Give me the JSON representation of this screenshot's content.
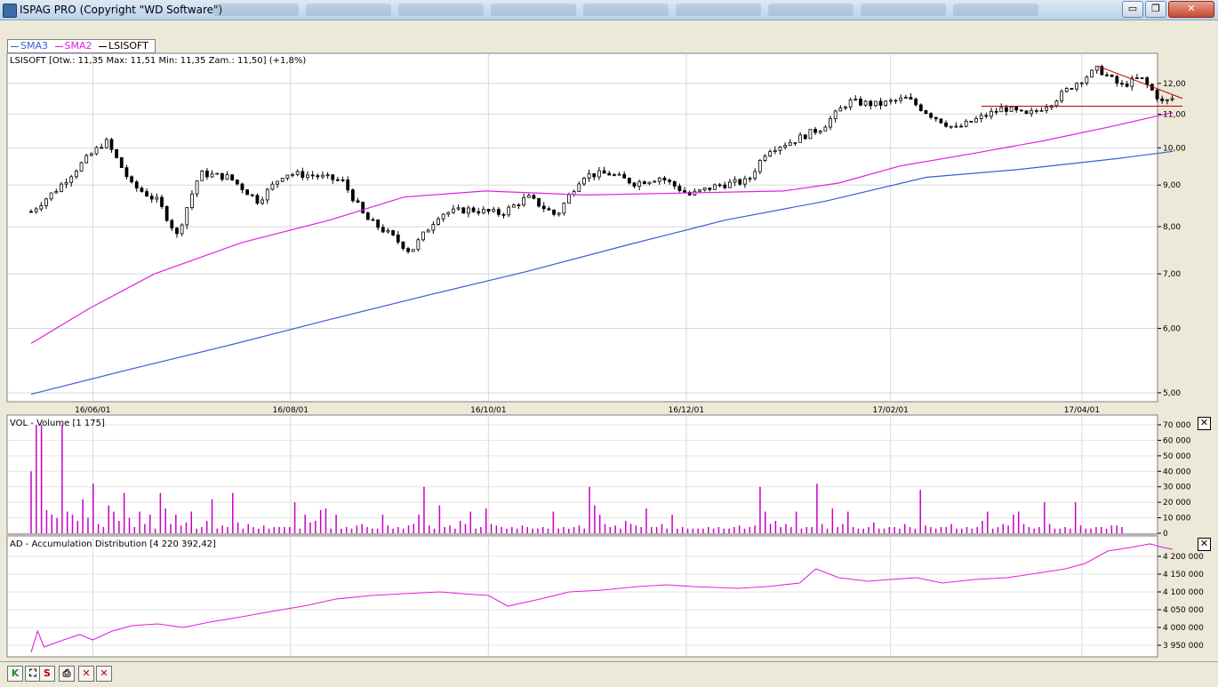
{
  "window": {
    "title": "ISPAG PRO (Copyright \"WD Software\")",
    "minimize_glyph": "▭",
    "restore_glyph": "❐",
    "close_glyph": "✕"
  },
  "legend": {
    "items": [
      {
        "label": "SMA3",
        "color": "#3a5fcd"
      },
      {
        "label": "SMA2",
        "color": "#e020e0"
      },
      {
        "label": "LSISOFT",
        "color": "#000000"
      }
    ]
  },
  "price_panel": {
    "info": "LSISOFT [Otw.: 11,35  Max: 11,51  Min: 11,35  Zam.: 11,50] (+1,8%)",
    "y_ticks": [
      "12,00",
      "11,00",
      "10,00",
      "9,00",
      "8,00",
      "7,00",
      "6,00",
      "5,00"
    ],
    "x_ticks": [
      "16/06/01",
      "16/08/01",
      "16/10/01",
      "16/12/01",
      "17/02/01",
      "17/04/01"
    ]
  },
  "volume_panel": {
    "info": "VOL - Volume [1 175]",
    "y_ticks": [
      "70 000",
      "60 000",
      "50 000",
      "40 000",
      "30 000",
      "20 000",
      "10 000",
      "0"
    ],
    "close_glyph": "✕"
  },
  "ad_panel": {
    "info": "AD - Accumulation Distribution [4 220 392,42]",
    "y_ticks": [
      "4 200 000",
      "4 150 000",
      "4 100 000",
      "4 050 000",
      "4 000 000",
      "3 950 000"
    ],
    "close_glyph": "✕"
  },
  "toolbar": {
    "buttons": [
      {
        "label": "K",
        "icon": "k-icon"
      },
      {
        "label": "⛶",
        "icon": "fit-icon"
      },
      {
        "label": "S",
        "icon": "s-icon"
      },
      {
        "label": "⎙",
        "icon": "print-icon"
      },
      {
        "label": "✕",
        "icon": "delete-icon"
      },
      {
        "label": "✕",
        "icon": "delete-all-icon"
      }
    ]
  },
  "chart_data": [
    {
      "type": "candlestick",
      "scale": "log",
      "title": "LSISOFT",
      "ylim": [
        4.9,
        13.0
      ],
      "x_range": [
        "2001-05-28",
        "2002-05-18"
      ],
      "x_tick_dates": [
        "2001-06-16",
        "2001-08-16",
        "2001-10-16",
        "2001-12-16",
        "2002-02-17",
        "2002-04-17"
      ],
      "grid": true,
      "legend_position": "top-left",
      "series_colors": {
        "SMA3": "#3a5fcd",
        "SMA2": "#e020e0",
        "LSISOFT": "#000000"
      },
      "close": [
        [
          [
            "2001-05-28",
            8.35
          ]
        ],
        [
          [
            "2001-06-05",
            8.9
          ]
        ],
        [
          [
            "2001-06-13",
            9.6
          ]
        ],
        [
          [
            "2001-06-20",
            10.2
          ]
        ],
        [
          [
            "2001-06-28",
            9.0
          ]
        ],
        [
          [
            "2001-07-06",
            8.6
          ]
        ],
        [
          [
            "2001-07-12",
            7.8
          ]
        ],
        [
          [
            "2001-07-19",
            9.3
          ]
        ],
        [
          [
            "2001-07-28",
            9.2
          ]
        ],
        [
          [
            "2001-08-06",
            8.6
          ]
        ],
        [
          [
            "2001-08-14",
            9.3
          ]
        ],
        [
          [
            "2001-08-23",
            9.25
          ]
        ],
        [
          [
            "2001-09-01",
            9.1
          ]
        ],
        [
          [
            "2001-09-08",
            8.2
          ]
        ],
        [
          [
            "2001-09-16",
            7.8
          ]
        ],
        [
          [
            "2001-09-22",
            7.45
          ]
        ],
        [
          [
            "2001-10-01",
            8.3
          ]
        ],
        [
          [
            "2001-10-10",
            8.4
          ]
        ],
        [
          [
            "2001-10-20",
            8.3
          ]
        ],
        [
          [
            "2001-10-28",
            8.7
          ]
        ],
        [
          [
            "2001-11-06",
            8.25
          ]
        ],
        [
          [
            "2001-11-14",
            9.25
          ]
        ],
        [
          [
            "2001-11-22",
            9.3
          ]
        ],
        [
          [
            "2001-11-30",
            9.05
          ]
        ],
        [
          [
            "2001-12-08",
            9.2
          ]
        ],
        [
          [
            "2001-12-17",
            8.75
          ]
        ],
        [
          [
            "2001-12-26",
            9.0
          ]
        ],
        [
          [
            "2002-01-04",
            9.1
          ]
        ],
        [
          [
            "2002-01-10",
            9.95
          ]
        ],
        [
          [
            "2002-01-18",
            10.2
          ]
        ],
        [
          [
            "2002-01-27",
            10.6
          ]
        ],
        [
          [
            "2002-02-04",
            11.4
          ]
        ],
        [
          [
            "2002-02-13",
            11.3
          ]
        ],
        [
          [
            "2002-02-22",
            11.5
          ]
        ],
        [
          [
            "2002-03-01",
            11.0
          ]
        ],
        [
          [
            "2002-03-09",
            10.55
          ]
        ],
        [
          [
            "2002-03-17",
            10.9
          ]
        ],
        [
          [
            "2002-03-24",
            11.2
          ]
        ],
        [
          [
            "2002-03-31",
            10.95
          ]
        ],
        [
          [
            "2002-04-08",
            11.4
          ]
        ],
        [
          [
            "2002-04-15",
            12.0
          ]
        ],
        [
          [
            "2002-04-22",
            12.5
          ]
        ],
        [
          [
            "2002-04-29",
            11.9
          ]
        ],
        [
          [
            "2002-05-05",
            12.2
          ]
        ],
        [
          [
            "2002-05-12",
            11.35
          ]
        ],
        [
          [
            "2002-05-15",
            11.5
          ]
        ]
      ],
      "series": [
        {
          "name": "SMA3",
          "values": [
            [
              "2001-05-28",
              4.98
            ],
            [
              "2001-06-28",
              5.35
            ],
            [
              "2001-07-28",
              5.72
            ],
            [
              "2001-08-28",
              6.15
            ],
            [
              "2001-09-28",
              6.6
            ],
            [
              "2001-10-28",
              7.05
            ],
            [
              "2001-11-28",
              7.6
            ],
            [
              "2001-12-28",
              8.15
            ],
            [
              "2002-01-28",
              8.6
            ],
            [
              "2002-02-28",
              9.2
            ],
            [
              "2002-03-28",
              9.4
            ],
            [
              "2002-04-28",
              9.7
            ],
            [
              "2002-05-15",
              9.9
            ]
          ]
        },
        {
          "name": "SMA2",
          "values": [
            [
              "2001-05-28",
              5.75
            ],
            [
              "2001-06-15",
              6.35
            ],
            [
              "2001-07-05",
              7.0
            ],
            [
              "2001-08-01",
              7.65
            ],
            [
              "2001-08-28",
              8.15
            ],
            [
              "2001-09-20",
              8.7
            ],
            [
              "2001-10-15",
              8.85
            ],
            [
              "2001-11-15",
              8.75
            ],
            [
              "2001-12-15",
              8.8
            ],
            [
              "2002-01-15",
              8.85
            ],
            [
              "2002-02-01",
              9.05
            ],
            [
              "2002-02-20",
              9.5
            ],
            [
              "2002-03-15",
              9.85
            ],
            [
              "2002-04-05",
              10.2
            ],
            [
              "2002-04-25",
              10.6
            ],
            [
              "2002-05-15",
              11.05
            ]
          ]
        }
      ],
      "annotations": [
        {
          "type": "resistance_trendline",
          "from": [
            "2002-04-22",
            12.6
          ],
          "to": [
            "2002-05-18",
            11.5
          ],
          "color": "#c00000"
        },
        {
          "type": "support_line",
          "from": [
            "2002-03-17",
            11.25
          ],
          "to": [
            "2002-05-18",
            11.25
          ],
          "color": "#c00000"
        }
      ]
    },
    {
      "type": "bar",
      "title": "VOL - Volume",
      "ylim": [
        0,
        70000
      ],
      "grid": true,
      "series_color": "#c800c8",
      "approx_values_peak_labels": [
        {
          "x": "2001-05-29",
          "value": 70000
        },
        {
          "x": "2001-06-08",
          "value": 70000
        },
        {
          "x": "2001-12-10",
          "value": 30000
        },
        {
          "x": "2002-01-15",
          "value": 30000
        },
        {
          "x": "2002-02-01",
          "value": 32000
        },
        {
          "x": "2002-03-10",
          "value": 26000
        }
      ],
      "values": [
        40000,
        70000,
        70000,
        15000,
        12000,
        10000,
        70000,
        14000,
        12000,
        8000,
        22000,
        10000,
        32000,
        6000,
        4000,
        18000,
        14000,
        8000,
        26000,
        10000,
        4000,
        14000,
        6000,
        12000,
        3000,
        26000,
        16000,
        6000,
        12000,
        5000,
        7000,
        14000,
        3000,
        4000,
        8000,
        22000,
        3000,
        5000,
        4000,
        26000,
        7000,
        3000,
        6000,
        4000,
        3000,
        5000,
        3000,
        4000,
        4000,
        4000,
        4000,
        20000,
        3000,
        12000,
        7000,
        8000,
        15000,
        16000,
        3000,
        12000,
        3000,
        4000,
        3000,
        5000,
        6000,
        4000,
        3000,
        3000,
        12000,
        5000,
        3000,
        4000,
        3000,
        5000,
        6000,
        12000,
        30000,
        5000,
        3000,
        18000,
        4000,
        5000,
        3000,
        8000,
        6000,
        14000,
        3000,
        4000,
        16000,
        6000,
        5000,
        4000,
        3000,
        4000,
        3000,
        5000,
        4000,
        3000,
        3000,
        4000,
        3000,
        14000,
        3000,
        4000,
        3000,
        4000,
        5000,
        3000,
        30000,
        18000,
        12000,
        6000,
        4000,
        5000,
        3000,
        8000,
        6000,
        5000,
        4000,
        16000,
        4000,
        4000,
        6000,
        3000,
        12000,
        3000,
        4000,
        3000,
        3000,
        3000,
        3000,
        4000,
        3000,
        4000,
        3000,
        3000,
        4000,
        5000,
        3000,
        4000,
        5000,
        30000,
        14000,
        6000,
        8000,
        4000,
        6000,
        4000,
        14000,
        3000,
        4000,
        4000,
        32000,
        6000,
        3000,
        16000,
        4000,
        6000,
        14000,
        4000,
        3000,
        3000,
        4000,
        7000,
        3000,
        3000,
        4000,
        4000,
        3000,
        6000,
        4000,
        3000,
        28000,
        5000,
        4000,
        3000,
        4000,
        4000,
        6000,
        3000,
        3000,
        4000,
        3000,
        4000,
        8000,
        14000,
        3000,
        4000,
        6000,
        5000,
        12000,
        14000,
        6000,
        4000,
        3000,
        4000,
        20000,
        6000,
        3000,
        3000,
        4000,
        3000,
        20000,
        5000,
        3000,
        3000,
        4000,
        4000,
        3000,
        5000,
        5000,
        4000
      ]
    },
    {
      "type": "line",
      "title": "AD - Accumulation Distribution",
      "ylim": [
        3920000,
        4240000
      ],
      "grid": true,
      "series_color": "#e020e0",
      "values": [
        [
          "2001-05-28",
          3930000
        ],
        [
          "2001-05-30",
          3990000
        ],
        [
          "2001-06-01",
          3945000
        ],
        [
          "2001-06-07",
          3965000
        ],
        [
          "2001-06-12",
          3980000
        ],
        [
          "2001-06-16",
          3965000
        ],
        [
          "2001-06-22",
          3990000
        ],
        [
          "2001-06-28",
          4005000
        ],
        [
          "2001-07-06",
          4010000
        ],
        [
          "2001-07-14",
          4000000
        ],
        [
          "2001-07-22",
          4015000
        ],
        [
          "2001-08-01",
          4030000
        ],
        [
          "2001-08-10",
          4045000
        ],
        [
          "2001-08-20",
          4060000
        ],
        [
          "2001-08-30",
          4080000
        ],
        [
          "2001-09-10",
          4090000
        ],
        [
          "2001-09-20",
          4095000
        ],
        [
          "2001-10-01",
          4100000
        ],
        [
          "2001-10-08",
          4095000
        ],
        [
          "2001-10-16",
          4090000
        ],
        [
          "2001-10-22",
          4060000
        ],
        [
          "2001-11-01",
          4080000
        ],
        [
          "2001-11-10",
          4100000
        ],
        [
          "2001-11-20",
          4105000
        ],
        [
          "2001-12-01",
          4115000
        ],
        [
          "2001-12-10",
          4120000
        ],
        [
          "2001-12-18",
          4115000
        ],
        [
          "2002-01-01",
          4110000
        ],
        [
          "2002-01-10",
          4115000
        ],
        [
          "2002-01-20",
          4125000
        ],
        [
          "2002-01-25",
          4165000
        ],
        [
          "2002-02-01",
          4140000
        ],
        [
          "2002-02-10",
          4130000
        ],
        [
          "2002-02-17",
          4135000
        ],
        [
          "2002-02-25",
          4140000
        ],
        [
          "2002-03-05",
          4125000
        ],
        [
          "2002-03-15",
          4135000
        ],
        [
          "2002-03-25",
          4140000
        ],
        [
          "2002-04-05",
          4155000
        ],
        [
          "2002-04-12",
          4165000
        ],
        [
          "2002-04-18",
          4180000
        ],
        [
          "2002-04-25",
          4215000
        ],
        [
          "2002-05-02",
          4225000
        ],
        [
          "2002-05-08",
          4235000
        ],
        [
          "2002-05-12",
          4225000
        ],
        [
          "2002-05-15",
          4220000
        ]
      ]
    }
  ]
}
